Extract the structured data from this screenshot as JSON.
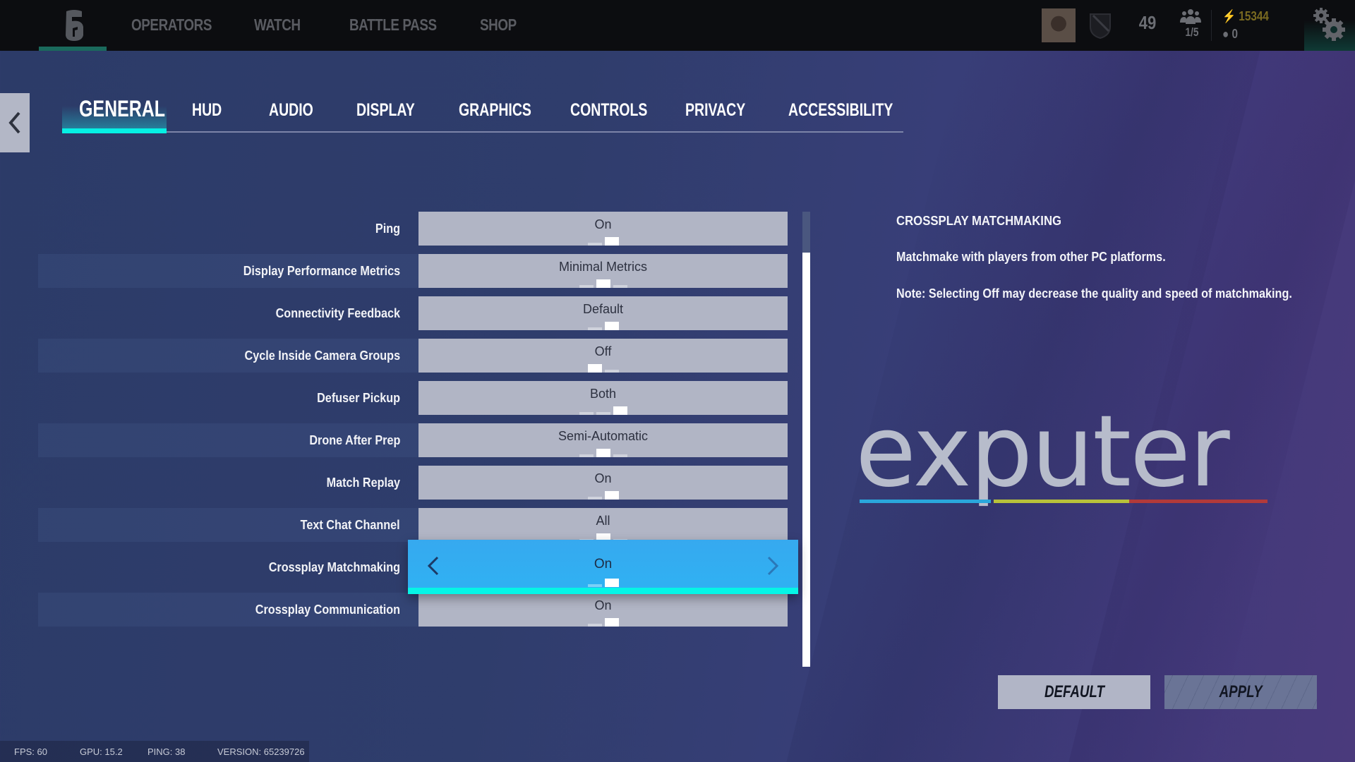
{
  "topbar": {
    "logo": "rainbow-six-logo",
    "nav": [
      "OPERATORS",
      "WATCH",
      "BATTLE PASS",
      "SHOP"
    ],
    "level": "49",
    "squad_count": "1/5",
    "renown": "15344",
    "credits": "0"
  },
  "tabs": [
    "GENERAL",
    "HUD",
    "AUDIO",
    "DISPLAY",
    "GRAPHICS",
    "CONTROLS",
    "PRIVACY",
    "ACCESSIBILITY"
  ],
  "active_tab": "GENERAL",
  "settings": [
    {
      "label": "Ping",
      "value": "On",
      "options_count": 2,
      "selected_index": 1
    },
    {
      "label": "Display Performance Metrics",
      "value": "Minimal Metrics",
      "options_count": 3,
      "selected_index": 1
    },
    {
      "label": "Connectivity Feedback",
      "value": "Default",
      "options_count": 2,
      "selected_index": 1
    },
    {
      "label": "Cycle Inside Camera Groups",
      "value": "Off",
      "options_count": 2,
      "selected_index": 0
    },
    {
      "label": "Defuser Pickup",
      "value": "Both",
      "options_count": 3,
      "selected_index": 2
    },
    {
      "label": "Drone After Prep",
      "value": "Semi-Automatic",
      "options_count": 3,
      "selected_index": 1
    },
    {
      "label": "Match Replay",
      "value": "On",
      "options_count": 2,
      "selected_index": 1
    },
    {
      "label": "Text Chat Channel",
      "value": "All",
      "options_count": 3,
      "selected_index": 1
    },
    {
      "label": "Crossplay Matchmaking",
      "value": "On",
      "options_count": 2,
      "selected_index": 1,
      "focused": true
    },
    {
      "label": "Crossplay Communication",
      "value": "On",
      "options_count": 2,
      "selected_index": 1
    }
  ],
  "description": {
    "title": "CROSSPLAY MATCHMAKING",
    "lines": [
      "Matchmake with players from other PC platforms.",
      "Note: Selecting Off may decrease the quality and speed of matchmaking."
    ]
  },
  "watermark": {
    "text": "exputer",
    "colors": [
      "#2aa7dc",
      "#b8c23a",
      "#b23a3a"
    ]
  },
  "buttons": {
    "default": "DEFAULT",
    "apply": "APPLY"
  },
  "footer": {
    "fps": "FPS: 60",
    "gpu": "GPU: 15.2",
    "ping": "PING: 38",
    "version": "VERSION: 65239726"
  },
  "colors": {
    "accent_cyan": "#06f0e4",
    "focus_blue": "#34adf0",
    "renown_gold": "#7a6a20"
  }
}
